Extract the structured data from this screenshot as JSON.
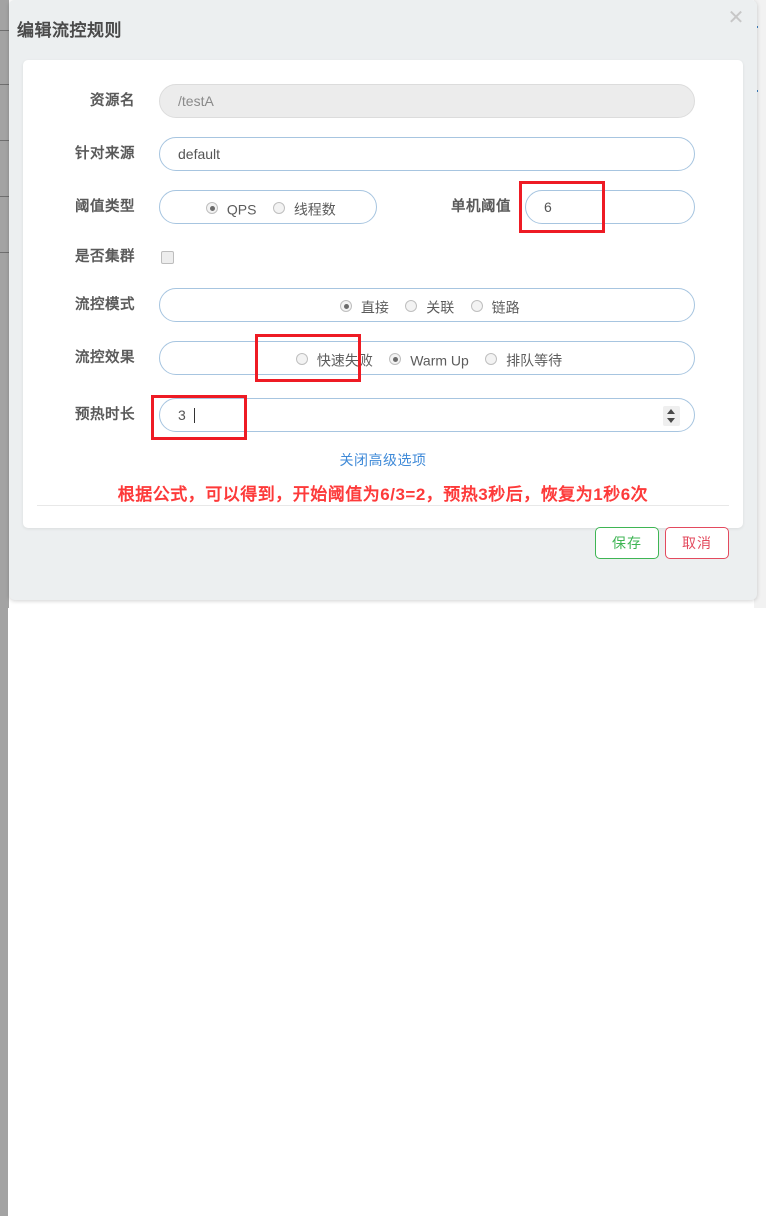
{
  "dialog": {
    "title": "编辑流控规则",
    "close_icon": "close-icon"
  },
  "form": {
    "resource": {
      "label": "资源名",
      "value": "/testA",
      "disabled": true
    },
    "limit_app": {
      "label": "针对来源",
      "value": "default"
    },
    "threshold_type": {
      "label": "阈值类型",
      "options": [
        {
          "label": "QPS",
          "checked": true
        },
        {
          "label": "线程数",
          "checked": false
        }
      ]
    },
    "single_threshold": {
      "label": "单机阈值",
      "value": "6",
      "highlighted": true
    },
    "cluster": {
      "label": "是否集群",
      "checked": false
    },
    "flow_mode": {
      "label": "流控模式",
      "options": [
        {
          "label": "直接",
          "checked": true
        },
        {
          "label": "关联",
          "checked": false
        },
        {
          "label": "链路",
          "checked": false
        }
      ]
    },
    "flow_effect": {
      "label": "流控效果",
      "options": [
        {
          "label": "快速失败",
          "checked": false
        },
        {
          "label": "Warm Up",
          "checked": true,
          "highlighted": true
        },
        {
          "label": "排队等待",
          "checked": false
        }
      ]
    },
    "warmup_duration": {
      "label": "预热时长",
      "value": "3",
      "highlighted": true,
      "spinner_icon": "number-spinner-icon"
    }
  },
  "advanced_link": {
    "label": "关闭高级选项"
  },
  "note": {
    "text": "根据公式，可以得到，开始阈值为6/3=2，预热3秒后，恢复为1秒6次",
    "color": "#fd3a3a"
  },
  "footer": {
    "save_label": "保存",
    "cancel_label": "取消"
  },
  "colors": {
    "accent_blue": "#3f8ad8",
    "save_green": "#3fb554",
    "cancel_red": "#e34a5e",
    "annotation_red": "#ee1b24"
  }
}
